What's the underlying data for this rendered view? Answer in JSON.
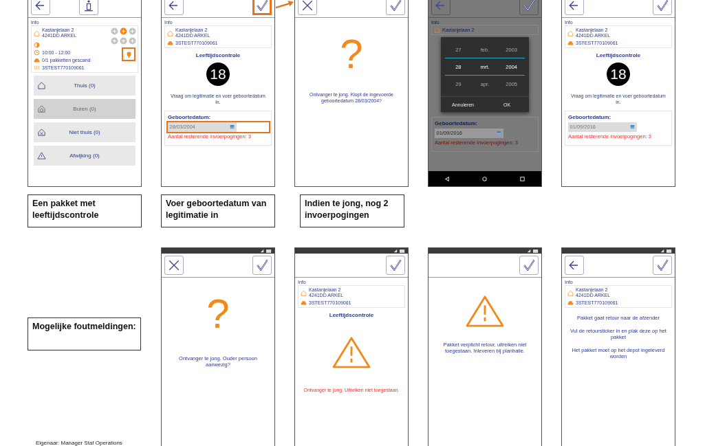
{
  "top_screens": [
    {
      "header": {
        "kind": "back_info"
      },
      "blocks": [
        {
          "kind": "section_label",
          "text": "Info"
        },
        {
          "kind": "delivery_card",
          "address_line1": "Kastanjelaan 2",
          "address_line2": "4241DD ARKEL",
          "time": "10:00 - 12:00",
          "parcels": "0/1 pakketten gescand",
          "barcode": "3STEST770109061",
          "status_icons": [
            {
              "color": "#c4c4c4"
            },
            {
              "color": "#f08a1c"
            },
            {
              "color": "#c4c4c4"
            },
            {
              "color": "#c4c4c4"
            },
            {
              "color": "#c4c4c4"
            },
            {
              "color": "#c4c4c4"
            }
          ],
          "flag_highlighted": true
        },
        {
          "kind": "action_buttons",
          "items": [
            {
              "label": "Thuis (0)",
              "disabled": false
            },
            {
              "label": "Buren (0)",
              "disabled": true
            },
            {
              "label": "Niet thuis (0)",
              "disabled": false
            },
            {
              "label": "Afwijking (0)",
              "disabled": false
            }
          ]
        }
      ]
    },
    {
      "next_arrow": true,
      "header": {
        "kind": "back_check",
        "highlighted": true
      },
      "blocks": [
        {
          "kind": "section_label",
          "text": "Info"
        },
        {
          "kind": "info_card",
          "address_line1": "Kastanjelaan 2",
          "address_line2": "4241DD ARKEL",
          "barcode": "3STEST770109061"
        },
        {
          "kind": "title",
          "text": "Leeftijdscontrole"
        },
        {
          "kind": "age_badge",
          "text": "18"
        },
        {
          "kind": "message",
          "text": "Vraag om legitimatie en voer geboortedatum in."
        },
        {
          "kind": "date_panel",
          "label": "Geboortedatum:",
          "value": "28/03/2004",
          "hint": "Aantal resterende invoerpogingen: 3",
          "highlighted": true
        }
      ]
    },
    {
      "header": {
        "kind": "close_check"
      },
      "blocks": [
        {
          "kind": "question",
          "text": "?"
        },
        {
          "kind": "message",
          "text": "Ontvanger te jong. Klopt de ingevoerde geboortedatum 28/03/2004?"
        }
      ]
    },
    {
      "dimmed": true,
      "nav_bar": true,
      "header": {
        "kind": "back_check"
      },
      "blocks": [
        {
          "kind": "section_label",
          "text": "Info"
        },
        {
          "kind": "info_card",
          "address_line1": "Kastanjelaan 2"
        },
        {
          "kind": "date_picker",
          "rows": [
            {
              "cells": [
                "27",
                "feb.",
                "2003"
              ],
              "selected": false
            },
            {
              "cells": [
                "28",
                "mrt.",
                "2004"
              ],
              "selected": true
            },
            {
              "cells": [
                "29",
                "apr.",
                "2005"
              ],
              "selected": false
            }
          ],
          "buttons": [
            "Annuleren",
            "OK"
          ]
        },
        {
          "kind": "date_panel",
          "label": "Geboortedatum:",
          "value": "01/09/2016",
          "hint": "Aantal resterende invoerpogingen: 3"
        }
      ]
    },
    {
      "header": {
        "kind": "back_check"
      },
      "blocks": [
        {
          "kind": "section_label",
          "text": "Info"
        },
        {
          "kind": "info_card",
          "address_line1": "Kastanjelaan 2",
          "address_line2": "4241DD ARKEL",
          "barcode": "3STEST770109061"
        },
        {
          "kind": "title",
          "text": "Leeftijdscontrole"
        },
        {
          "kind": "age_badge",
          "text": "18"
        },
        {
          "kind": "message",
          "text": "Vraag om legitimatie en voer geboortedatum in."
        },
        {
          "kind": "date_panel",
          "label": "Geboortedatum:",
          "value": "01/09/2016",
          "hint": "Aantal resterende invoerpogingen: 3"
        }
      ]
    }
  ],
  "top_captions": [
    "Een pakket met leeftijdscontrole",
    "Voer geboortedatum van legitimatie in",
    "Indien te jong, nog 2 invoerpogingen"
  ],
  "bottom_caption": "Mogelijke foutmeldingen:",
  "footer": "Eigenaar: Manager Staf Operations",
  "bottom_screens": [
    {
      "status_bar": true,
      "header": {
        "kind": "close_check"
      },
      "blocks": [
        {
          "kind": "question",
          "text": "?"
        },
        {
          "kind": "message",
          "text": "Ontvanger te jong. Ouder persoon aanwezig?"
        }
      ]
    },
    {
      "status_bar": true,
      "header": {
        "kind": "check"
      },
      "blocks": [
        {
          "kind": "section_label",
          "text": "Info"
        },
        {
          "kind": "info_card",
          "address_line1": "Kastanjelaan 2",
          "address_line2": "4241DD ARKEL",
          "barcode": "3STEST770109061"
        },
        {
          "kind": "title",
          "text": "Leeftijdscontrole"
        },
        {
          "kind": "warning"
        },
        {
          "kind": "error_message",
          "text": "Ontvanger te jong. Uitreiken niet toegestaan."
        }
      ]
    },
    {
      "status_bar": true,
      "header": {
        "kind": "check"
      },
      "blocks": [
        {
          "kind": "warning"
        },
        {
          "kind": "message",
          "text": "Pakket verplicht retour, uitreiken niet toegestaan. Inleveren bij planbalie."
        }
      ]
    },
    {
      "status_bar": true,
      "header": {
        "kind": "back_check"
      },
      "blocks": [
        {
          "kind": "section_label",
          "text": "Info"
        },
        {
          "kind": "info_card",
          "address_line1": "Kastanjelaan 2",
          "address_line2": "4241DD ARKEL",
          "barcode": "3STEST770109061"
        },
        {
          "kind": "message",
          "text": "Pakket gaat retour naar de afzender"
        },
        {
          "kind": "message",
          "text": "Vul de retoursticker in en plak deze op het pakket"
        },
        {
          "kind": "message",
          "text": "Het pakket moet op het depot ingeleverd worden"
        }
      ]
    }
  ]
}
